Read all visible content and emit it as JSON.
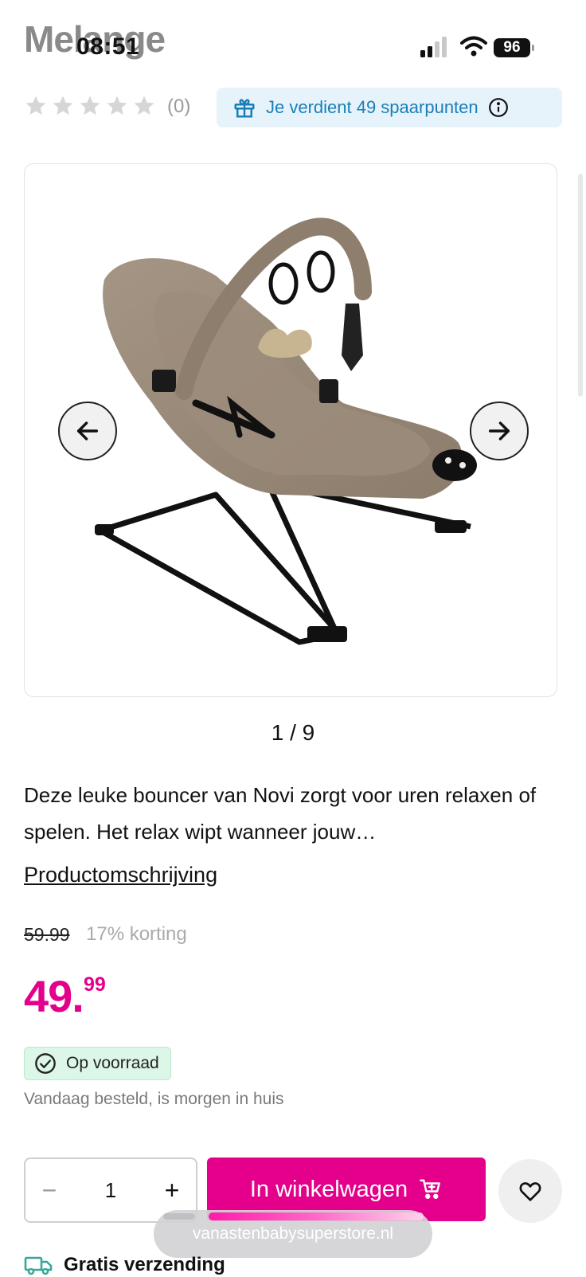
{
  "header": {
    "brand": "Melange"
  },
  "status_bar": {
    "time": "08:51",
    "battery": "96"
  },
  "rating": {
    "count": "(0)",
    "stars": 0,
    "max": 5
  },
  "points_banner": {
    "text": "Je verdient 49 spaarpunten"
  },
  "gallery": {
    "counter": "1 / 9",
    "icon_prev": "arrow-left-icon",
    "icon_next": "arrow-right-icon"
  },
  "description": {
    "text": "Deze leuke bouncer van Novi zorgt voor uren relaxen of spelen. Het relax wipt wanneer jouw…",
    "link": "Productomschrijving"
  },
  "price": {
    "old": "59.99",
    "discount": "17% korting",
    "main": "49.",
    "cents": "99"
  },
  "stock": {
    "badge": "Op voorraad",
    "note": "Vandaag besteld, is morgen in huis"
  },
  "purchase": {
    "quantity": "1",
    "minus": "−",
    "plus": "+",
    "cart_label": "In winkelwagen"
  },
  "browser": {
    "url": "vanastenbabysuperstore.nl"
  },
  "shipping": {
    "label": "Gratis verzending"
  },
  "colors": {
    "accent": "#e4008a",
    "info": "#1a7fb8",
    "stock_bg": "#dcf6e8"
  }
}
